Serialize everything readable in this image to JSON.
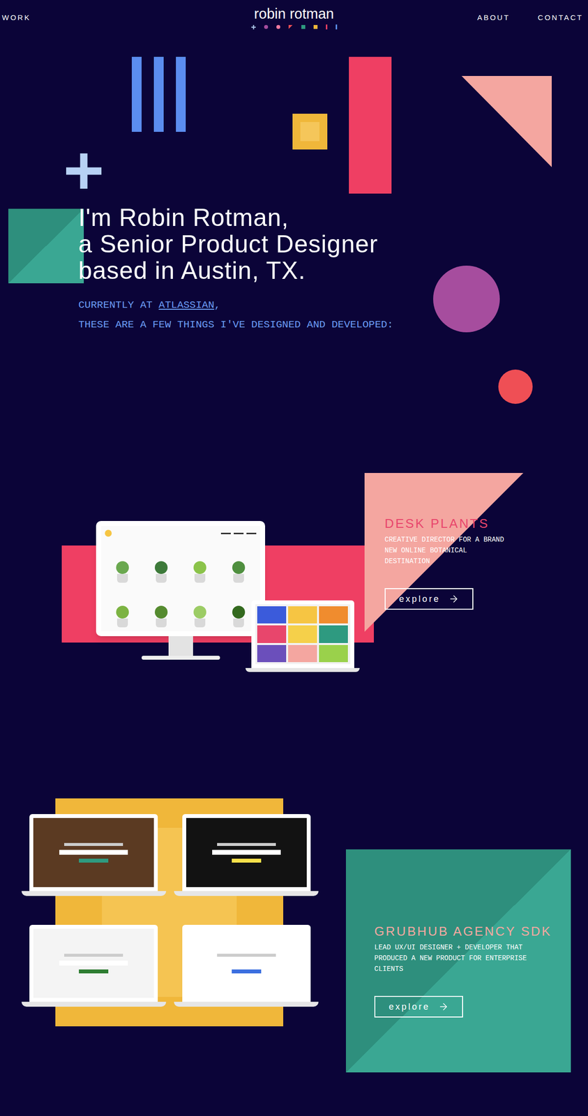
{
  "nav": {
    "left": [
      {
        "label": "WORK"
      }
    ],
    "logo": "robin rotman",
    "right": [
      {
        "label": "ABOUT"
      },
      {
        "label": "CONTACT"
      }
    ]
  },
  "hero": {
    "headline": [
      "I'm Robin Rotman,",
      "a Senior Product Designer",
      "based in Austin, TX."
    ],
    "intro": {
      "prefix": "CURRENTLY AT ",
      "company": "ATLASSIAN",
      "suffix": ",",
      "line2": "THESE ARE A FEW THINGS I'VE DESIGNED AND DEVELOPED:"
    }
  },
  "projects": [
    {
      "kind": "monitor",
      "title": "DESK PLANTS",
      "description": "CREATIVE DIRECTOR FOR A BRAND NEW ONLINE BOTANICAL DESTINATION",
      "button": "explore",
      "color": "#e8466c"
    },
    {
      "kind": "grid",
      "title": "GRUBHUB AGENCY SDK",
      "description": "LEAD UX/UI DESIGNER + DEVELOPER THAT PRODUCED A NEW PRODUCT FOR ENTERPRISE CLIENTS",
      "button": "explore",
      "color": "#f5a9a1"
    }
  ]
}
